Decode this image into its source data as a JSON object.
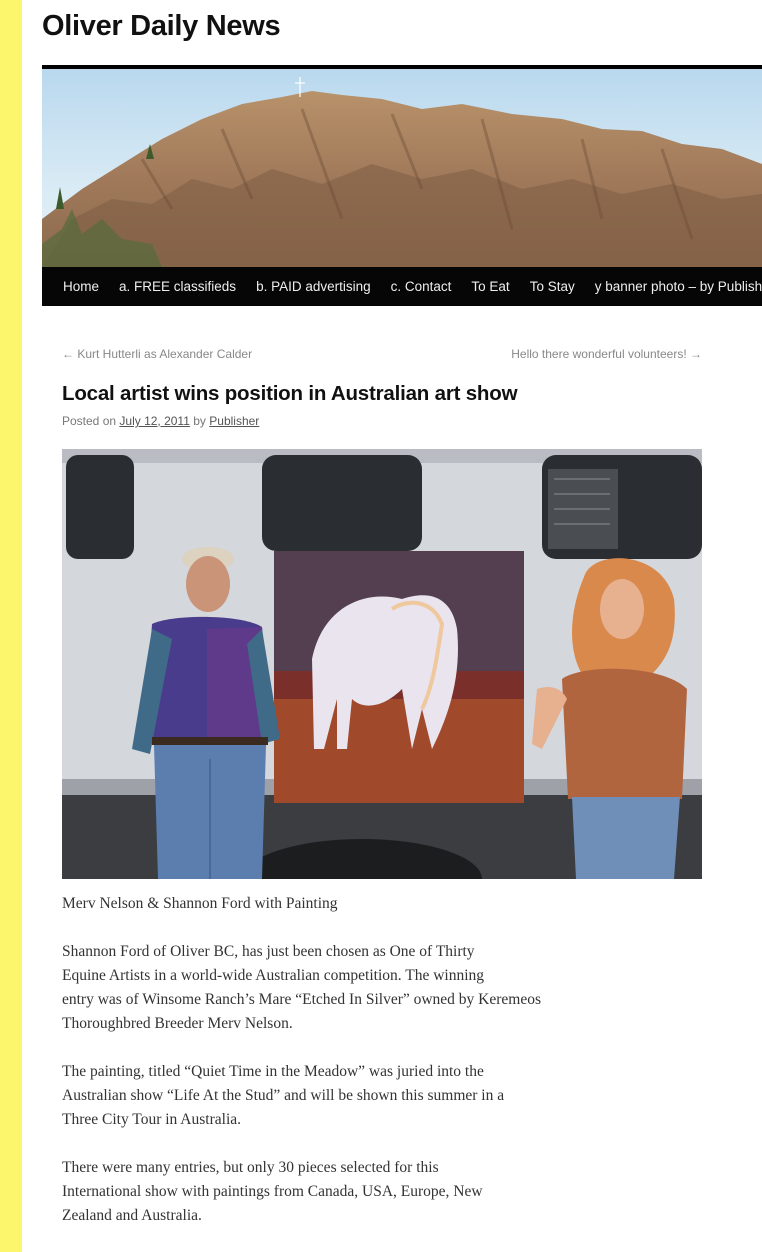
{
  "site": {
    "title": "Oliver Daily News"
  },
  "nav": {
    "items": [
      "Home",
      "a. FREE classifieds",
      "b. PAID advertising",
      "c. Contact",
      "To Eat",
      "To Stay",
      "y banner photo – by Publisher"
    ]
  },
  "post_nav": {
    "prev": "← Kurt Hutterli as Alexander Calder",
    "next": "Hello there wonderful volunteers! →"
  },
  "post": {
    "title": "Local artist wins position in Australian art show",
    "meta": {
      "posted_on": "Posted on",
      "date": "July 12, 2011",
      "by": "by",
      "author": "Publisher"
    },
    "caption": "Merv Nelson & Shannon Ford with Painting",
    "paragraphs": [
      [
        "Shannon Ford of Oliver BC, has just been chosen as One of Thirty",
        "Equine Artists in a world-wide Australian competition.  The winning",
        "entry was of Winsome Ranch’s Mare “Etched In Silver” owned by Keremeos",
        "Thoroughbred Breeder Merv Nelson."
      ],
      [
        "The painting, titled “Quiet Time in the Meadow” was juried into the",
        "Australian show “Life At the Stud” and will be shown this summer in a",
        "Three City Tour in Australia."
      ],
      [
        "There were many entries, but only 30 pieces selected for this",
        "International show with paintings from Canada, USA, Europe, New",
        "Zealand and Australia."
      ]
    ]
  },
  "colors": {
    "side_bar": "#fbf66c",
    "nav_bg": "#060606",
    "text": "#333333"
  }
}
